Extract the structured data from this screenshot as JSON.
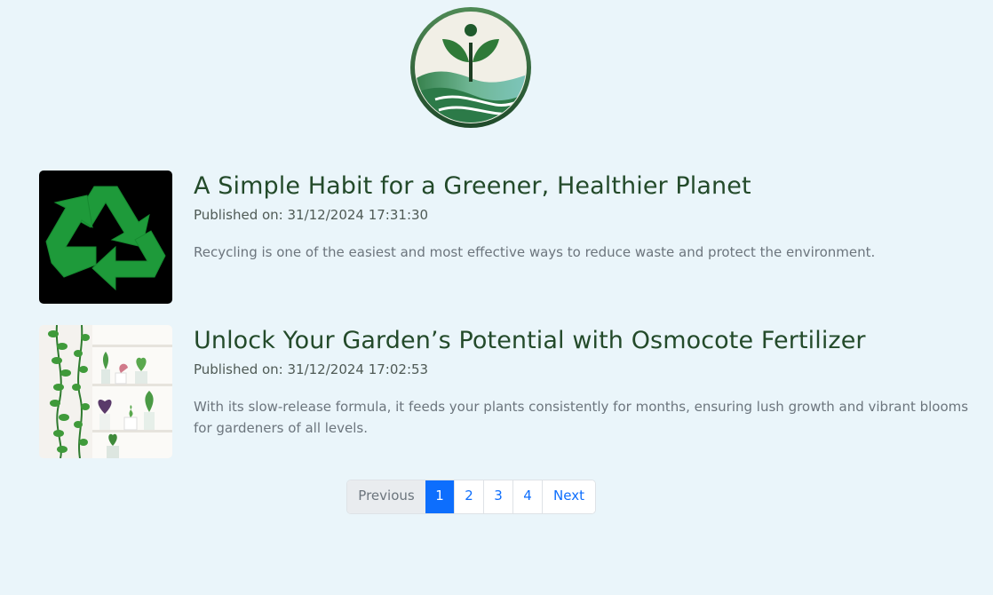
{
  "logo": {
    "icon": "sprout-logo-icon"
  },
  "posts": [
    {
      "title": "A Simple Habit for a Greener, Healthier Planet",
      "date": "Published on: 31/12/2024 17:31:30",
      "excerpt": "Recycling is one of the easiest and most effective ways to reduce waste and protect the environment.",
      "thumbnail": "recycle-icon"
    },
    {
      "title": "Unlock Your Garden’s Potential with Osmocote Fertilizer",
      "date": "Published on: 31/12/2024 17:02:53",
      "excerpt": "With its slow-release formula, it feeds your plants consistently for months, ensuring lush growth and vibrant blooms for gardeners of all levels.",
      "thumbnail": "houseplants-shelf-image"
    }
  ],
  "pagination": {
    "previous": "Previous",
    "pages": [
      "1",
      "2",
      "3",
      "4"
    ],
    "active": "1",
    "next": "Next"
  },
  "colors": {
    "background": "#eaf5fa",
    "title": "#234a2a",
    "link": "#0d6efd",
    "active": "#0d6efd"
  }
}
